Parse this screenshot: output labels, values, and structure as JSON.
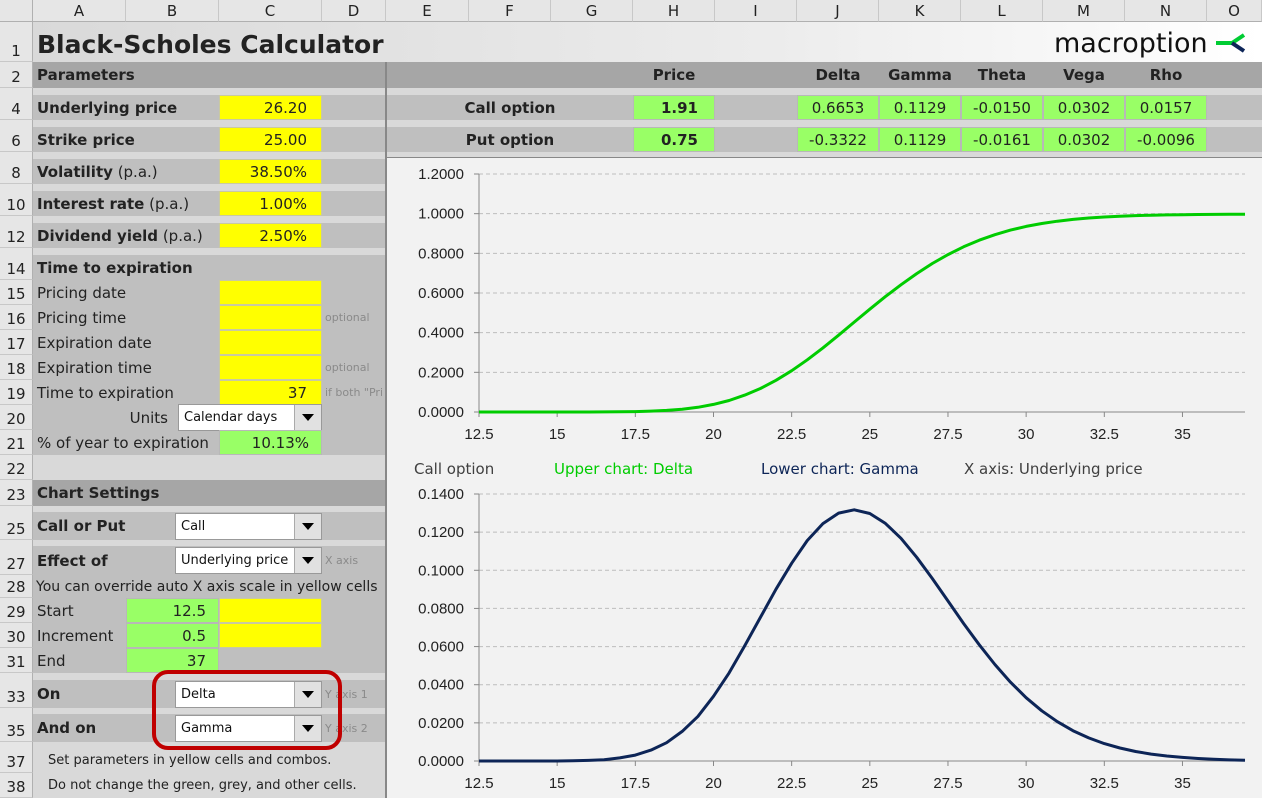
{
  "columns": [
    "A",
    "B",
    "C",
    "D",
    "E",
    "F",
    "G",
    "H",
    "I",
    "J",
    "K",
    "L",
    "M",
    "N",
    "O"
  ],
  "rows": [
    "1",
    "2",
    "4",
    "6",
    "8",
    "10",
    "12",
    "14",
    "15",
    "16",
    "17",
    "18",
    "19",
    "20",
    "21",
    "22",
    "23",
    "25",
    "27",
    "28",
    "29",
    "30",
    "31",
    "33",
    "35",
    "37",
    "38"
  ],
  "title": "Black-Scholes Calculator",
  "logo": {
    "text": "macroption",
    "colors": [
      "#00cc33",
      "#0d2557"
    ]
  },
  "parameters": {
    "header": "Parameters",
    "underlying": {
      "label": "Underlying price",
      "value": "26.20"
    },
    "strike": {
      "label": "Strike price",
      "value": "25.00"
    },
    "volatility": {
      "label": "Volatility",
      "suffix": "(p.a.)",
      "value": "38.50%"
    },
    "interest": {
      "label": "Interest rate",
      "suffix": "(p.a.)",
      "value": "1.00%"
    },
    "dividend": {
      "label": "Dividend yield",
      "suffix": "(p.a.)",
      "value": "2.50%"
    }
  },
  "time": {
    "header": "Time to expiration",
    "pricing_date": {
      "label": "Pricing date",
      "value": ""
    },
    "pricing_time": {
      "label": "Pricing time",
      "value": "",
      "note": "optional"
    },
    "expiration_date": {
      "label": "Expiration date",
      "value": ""
    },
    "expiration_time": {
      "label": "Expiration time",
      "value": "",
      "note": "optional"
    },
    "tte": {
      "label": "Time to expiration",
      "value": "37",
      "note": "if both \"Pri"
    },
    "units": {
      "label": "Units",
      "value": "Calendar days"
    },
    "pct": {
      "label": "% of year to expiration",
      "value": "10.13%"
    }
  },
  "chart_settings": {
    "header": "Chart Settings",
    "call_put": {
      "label": "Call or Put",
      "value": "Call"
    },
    "effect_of": {
      "label": "Effect of",
      "value": "Underlying price",
      "note": "X axis"
    },
    "override_note": "You can override auto X axis scale in yellow cells",
    "start": {
      "label": "Start",
      "value": "12.5"
    },
    "increment": {
      "label": "Increment",
      "value": "0.5"
    },
    "end": {
      "label": "End",
      "value": "37"
    },
    "on": {
      "label": "On",
      "value": "Delta",
      "note": "Y axis 1"
    },
    "and_on": {
      "label": "And on",
      "value": "Gamma",
      "note": "Y axis 2"
    },
    "help1": "Set parameters in yellow cells and combos.",
    "help2": "Do not change the green, grey, and other cells."
  },
  "results": {
    "headers": [
      "Price",
      "Delta",
      "Gamma",
      "Theta",
      "Vega",
      "Rho"
    ],
    "call": {
      "label": "Call option",
      "price": "1.91",
      "greeks": [
        "0.6653",
        "0.1129",
        "-0.0150",
        "0.0302",
        "0.0157"
      ]
    },
    "put": {
      "label": "Put option",
      "price": "0.75",
      "greeks": [
        "-0.3322",
        "0.1129",
        "-0.0161",
        "0.0302",
        "-0.0096"
      ]
    }
  },
  "caption": {
    "option": "Call option",
    "upper": "Upper chart: Delta",
    "lower": "Lower chart: Gamma",
    "xaxis": "X axis: Underlying price"
  },
  "highlight_color": "#c00000",
  "chart_data": [
    {
      "type": "line",
      "name": "Delta",
      "color": "#00cc00",
      "ylim": [
        0,
        1.2
      ],
      "yticks": [
        "0.0000",
        "0.2000",
        "0.4000",
        "0.6000",
        "0.8000",
        "1.0000",
        "1.2000"
      ],
      "xlim": [
        12.5,
        37
      ],
      "xticks": [
        "12.5",
        "15",
        "17.5",
        "20",
        "22.5",
        "25",
        "27.5",
        "30",
        "32.5",
        "35"
      ],
      "grid": true,
      "x": [
        12.5,
        13,
        13.5,
        14,
        14.5,
        15,
        15.5,
        16,
        16.5,
        17,
        17.5,
        18,
        18.5,
        19,
        19.5,
        20,
        20.5,
        21,
        21.5,
        22,
        22.5,
        23,
        23.5,
        24,
        24.5,
        25,
        25.5,
        26,
        26.5,
        27,
        27.5,
        28,
        28.5,
        29,
        29.5,
        30,
        30.5,
        31,
        31.5,
        32,
        32.5,
        33,
        33.5,
        34,
        34.5,
        35,
        35.5,
        36,
        36.5,
        37
      ],
      "y": [
        0,
        0,
        0,
        0,
        0,
        0,
        0.0001,
        0.0002,
        0.0004,
        0.001,
        0.0021,
        0.0043,
        0.008,
        0.0142,
        0.0238,
        0.0382,
        0.058,
        0.0851,
        0.1186,
        0.1598,
        0.2081,
        0.263,
        0.3231,
        0.3873,
        0.4533,
        0.5182,
        0.5819,
        0.6421,
        0.6979,
        0.7486,
        0.7937,
        0.8329,
        0.866,
        0.894,
        0.9169,
        0.9356,
        0.9503,
        0.962,
        0.9711,
        0.978,
        0.9832,
        0.9872,
        0.9901,
        0.9922,
        0.9938,
        0.9949,
        0.9957,
        0.9963,
        0.9966,
        0.9969
      ]
    },
    {
      "type": "line",
      "name": "Gamma",
      "color": "#0d2557",
      "ylim": [
        0,
        0.14
      ],
      "yticks": [
        "0.0000",
        "0.0200",
        "0.0400",
        "0.0600",
        "0.0800",
        "0.1000",
        "0.1200",
        "0.1400"
      ],
      "xlim": [
        12.5,
        37
      ],
      "xticks": [
        "12.5",
        "15",
        "17.5",
        "20",
        "22.5",
        "25",
        "27.5",
        "30",
        "32.5",
        "35"
      ],
      "grid": true,
      "x": [
        12.5,
        13,
        13.5,
        14,
        14.5,
        15,
        15.5,
        16,
        16.5,
        17,
        17.5,
        18,
        18.5,
        19,
        19.5,
        20,
        20.5,
        21,
        21.5,
        22,
        22.5,
        23,
        23.5,
        24,
        24.5,
        25,
        25.5,
        26,
        26.5,
        27,
        27.5,
        28,
        28.5,
        29,
        29.5,
        30,
        30.5,
        31,
        31.5,
        32,
        32.5,
        33,
        33.5,
        34,
        34.5,
        35,
        35.5,
        36,
        36.5,
        37
      ],
      "y": [
        0,
        0,
        0,
        0,
        0,
        0,
        0.0001,
        0.0003,
        0.0007,
        0.0016,
        0.0031,
        0.0057,
        0.0096,
        0.0155,
        0.0234,
        0.0339,
        0.0462,
        0.0605,
        0.0753,
        0.0901,
        0.1037,
        0.1156,
        0.1245,
        0.13,
        0.1317,
        0.1298,
        0.1246,
        0.1167,
        0.1068,
        0.0957,
        0.0839,
        0.0721,
        0.061,
        0.0506,
        0.0413,
        0.0332,
        0.0263,
        0.0206,
        0.0159,
        0.0121,
        0.0091,
        0.0068,
        0.005,
        0.0036,
        0.0026,
        0.0019,
        0.0013,
        0.0009,
        0.0006,
        0.0004
      ]
    }
  ]
}
